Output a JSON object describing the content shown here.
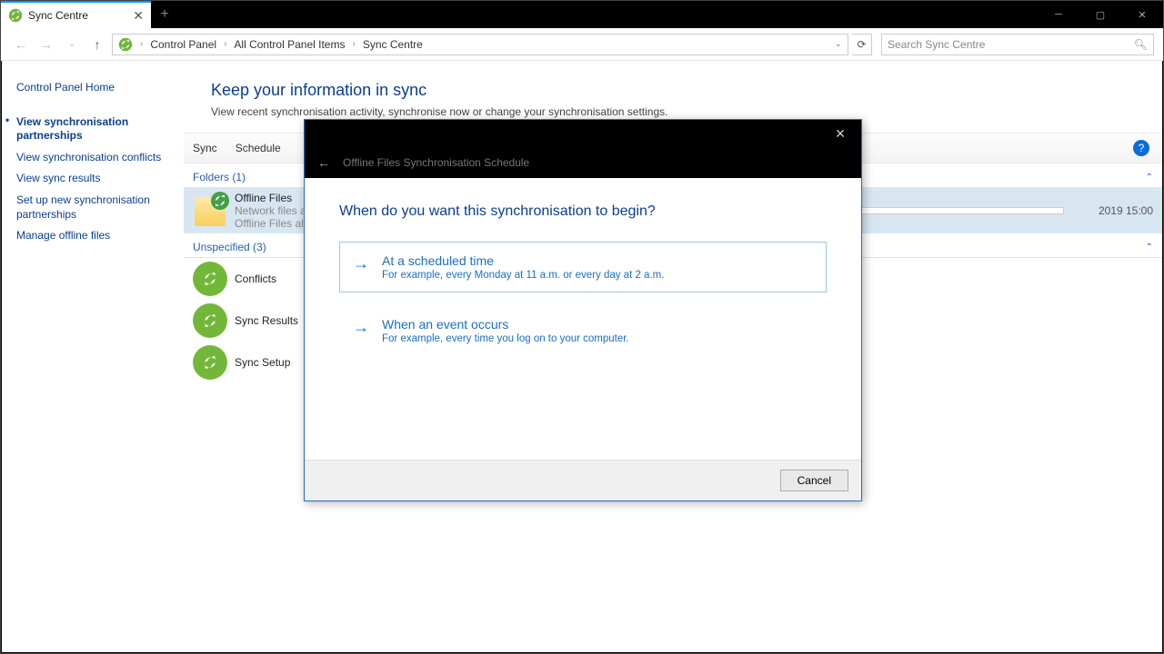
{
  "tab": {
    "title": "Sync Centre"
  },
  "breadcrumbs": [
    "Control Panel",
    "All Control Panel Items",
    "Sync Centre"
  ],
  "search": {
    "placeholder": "Search Sync Centre"
  },
  "sidebar": {
    "items": [
      {
        "label": "Control Panel Home"
      },
      {
        "label": "View synchronisation partnerships"
      },
      {
        "label": "View synchronisation conflicts"
      },
      {
        "label": "View sync results"
      },
      {
        "label": "Set up new synchronisation partnerships"
      },
      {
        "label": "Manage offline files"
      }
    ]
  },
  "main": {
    "title": "Keep your information in sync",
    "subtitle": "View recent synchronisation activity, synchronise now or change your synchronisation settings.",
    "menu": {
      "sync": "Sync",
      "schedule": "Schedule"
    },
    "groups": {
      "folders": {
        "header": "Folders (1)",
        "items": [
          {
            "title": "Offline Files",
            "sub1": "Network files available offline",
            "sub2": "Offline Files allows you to acce…",
            "time": "2019 15:00"
          }
        ]
      },
      "unspecified": {
        "header": "Unspecified (3)",
        "items": [
          {
            "title": "Conflicts"
          },
          {
            "title": "Sync Results"
          },
          {
            "title": "Sync Setup"
          }
        ]
      }
    }
  },
  "dialog": {
    "crumb": "Offline Files Synchronisation Schedule",
    "question": "When do you want this synchronisation to begin?",
    "options": [
      {
        "title": "At a scheduled time",
        "desc": "For example, every Monday at 11 a.m. or every day at 2 a.m."
      },
      {
        "title": "When an event occurs",
        "desc": "For example, every time you log on to your computer."
      }
    ],
    "cancel": "Cancel"
  }
}
